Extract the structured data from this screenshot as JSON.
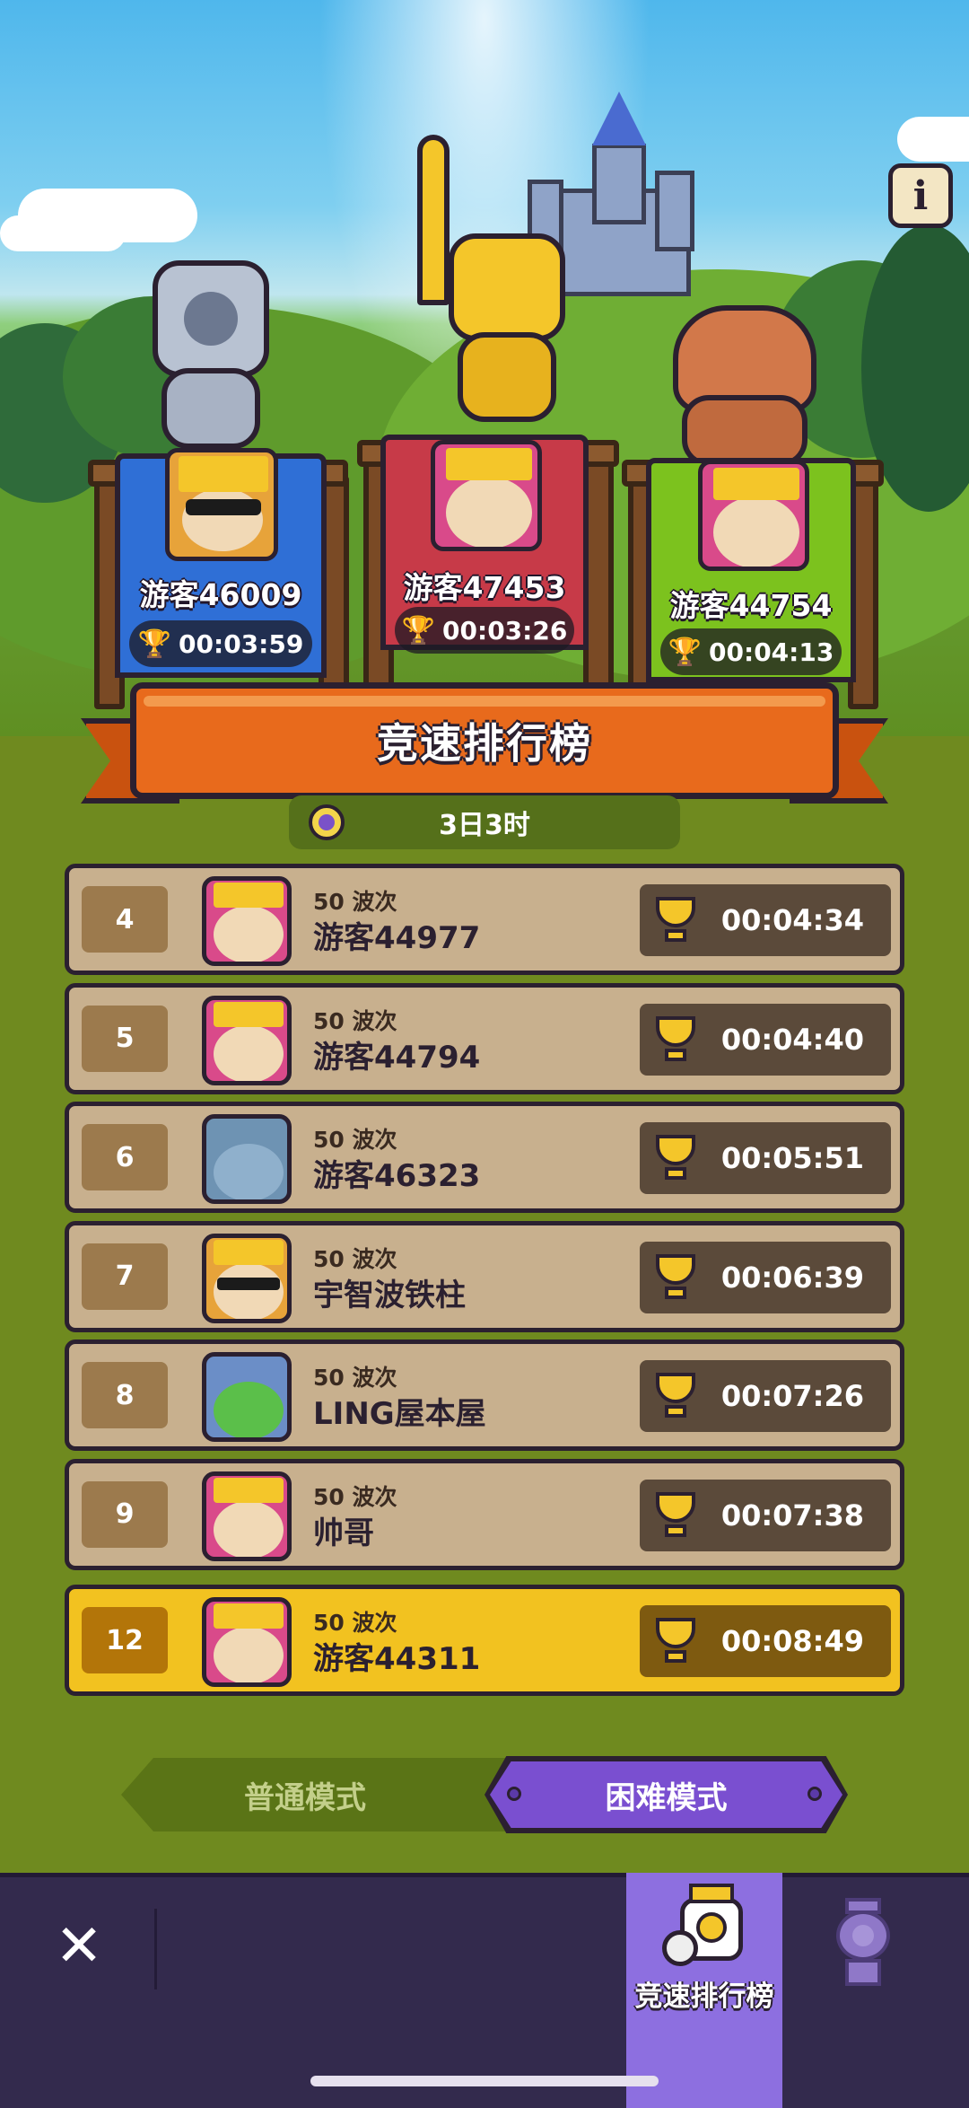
{
  "title": "竞速排行榜",
  "countdown": "3日3时",
  "podium": [
    {
      "rank": 2,
      "name": "游客46009",
      "time": "00:03:59",
      "banner_color": "#2f6fd6"
    },
    {
      "rank": 1,
      "name": "游客47453",
      "time": "00:03:26",
      "banner_color": "#c73a48"
    },
    {
      "rank": 3,
      "name": "游客44754",
      "time": "00:04:13",
      "banner_color": "#7cc21e"
    }
  ],
  "rows": [
    {
      "rank": "4",
      "wave": "50 波次",
      "name": "游客44977",
      "time": "00:04:34",
      "avatar": "king-avatar"
    },
    {
      "rank": "5",
      "wave": "50 波次",
      "name": "游客44794",
      "time": "00:04:40",
      "avatar": "king-avatar"
    },
    {
      "rank": "6",
      "wave": "50 波次",
      "name": "游客46323",
      "time": "00:05:51",
      "avatar": "blank-avatar"
    },
    {
      "rank": "7",
      "wave": "50 波次",
      "name": "宇智波铁柱",
      "time": "00:06:39",
      "avatar": "sunglasses-king-avatar"
    },
    {
      "rank": "8",
      "wave": "50 波次",
      "name": "LING屋本屋",
      "time": "00:07:26",
      "avatar": "frog-avatar"
    },
    {
      "rank": "9",
      "wave": "50 波次",
      "name": "帅哥",
      "time": "00:07:38",
      "avatar": "king-avatar"
    }
  ],
  "me": {
    "rank": "12",
    "wave": "50 波次",
    "name": "游客44311",
    "time": "00:08:49"
  },
  "modes": {
    "normal": "普通模式",
    "hard": "困难模式",
    "selected": "hard"
  },
  "bottom_tabs": {
    "active_label": "竞速排行榜"
  },
  "colors": {
    "accent_orange": "#e86a1c",
    "highlight_row": "#f2c220",
    "hard_mode": "#7a4fd0",
    "bar": "#332a4d"
  }
}
